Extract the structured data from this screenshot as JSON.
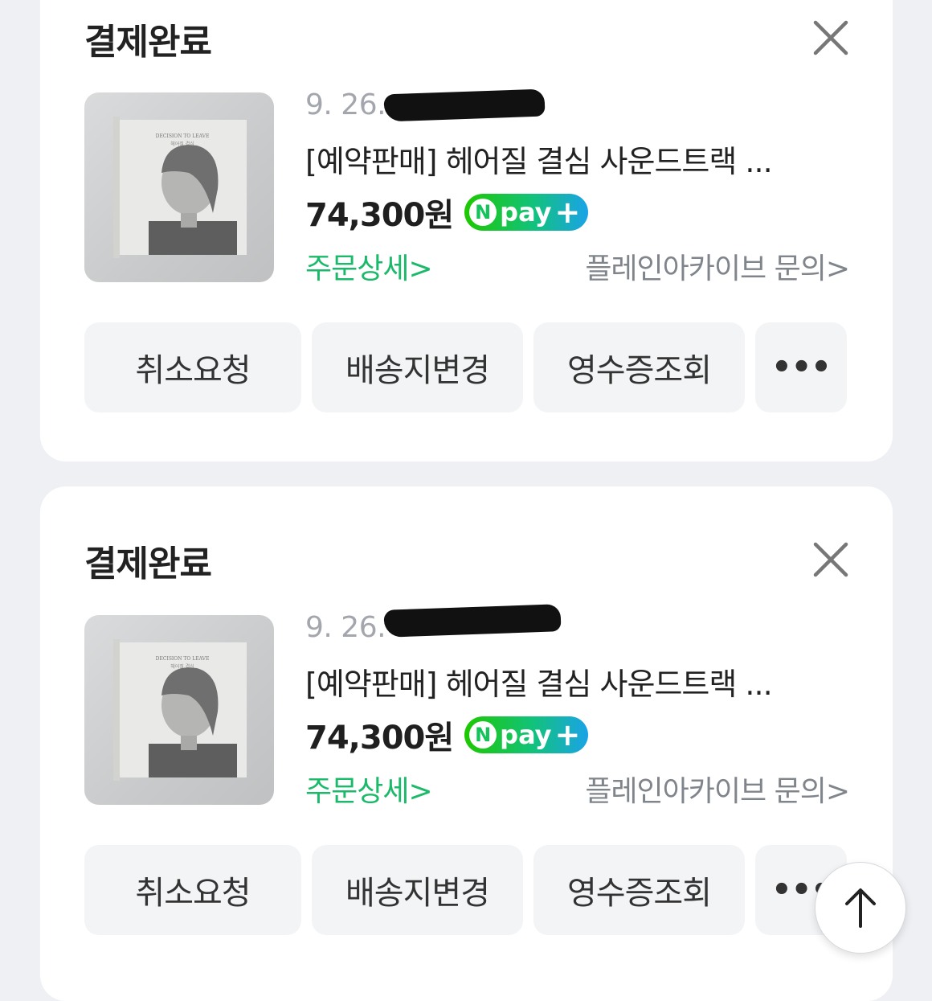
{
  "orders": [
    {
      "status": "결제완료",
      "date": "9. 26.",
      "title": "[예약판매] 헤어질 결심 사운드트랙 ...",
      "price": "74,300원",
      "npay": {
        "n": "N",
        "text": "pay",
        "plus": "+"
      },
      "detail_link": "주문상세>",
      "seller_link": "플레인아카이브 문의>",
      "product_cover": {
        "title": "DECISION TO LEAVE",
        "subtitle": "헤어질 결심"
      },
      "buttons": {
        "cancel": "취소요청",
        "address": "배송지변경",
        "receipt": "영수증조회",
        "more": "•••"
      }
    },
    {
      "status": "결제완료",
      "date": "9. 26.",
      "title": "[예약판매] 헤어질 결심 사운드트랙 ...",
      "price": "74,300원",
      "npay": {
        "n": "N",
        "text": "pay",
        "plus": "+"
      },
      "detail_link": "주문상세>",
      "seller_link": "플레인아카이브 문의>",
      "product_cover": {
        "title": "DECISION TO LEAVE",
        "subtitle": "헤어질 결심"
      },
      "buttons": {
        "cancel": "취소요청",
        "address": "배송지변경",
        "receipt": "영수증조회",
        "more": "•••"
      }
    }
  ],
  "colors": {
    "background": "#eef0f4",
    "card": "#ffffff",
    "accent_green": "#1bb96a",
    "button_bg": "#f2f4f6",
    "muted_text": "#80858c"
  },
  "icons": {
    "close": "close-icon",
    "scroll_top": "arrow-up-icon"
  }
}
